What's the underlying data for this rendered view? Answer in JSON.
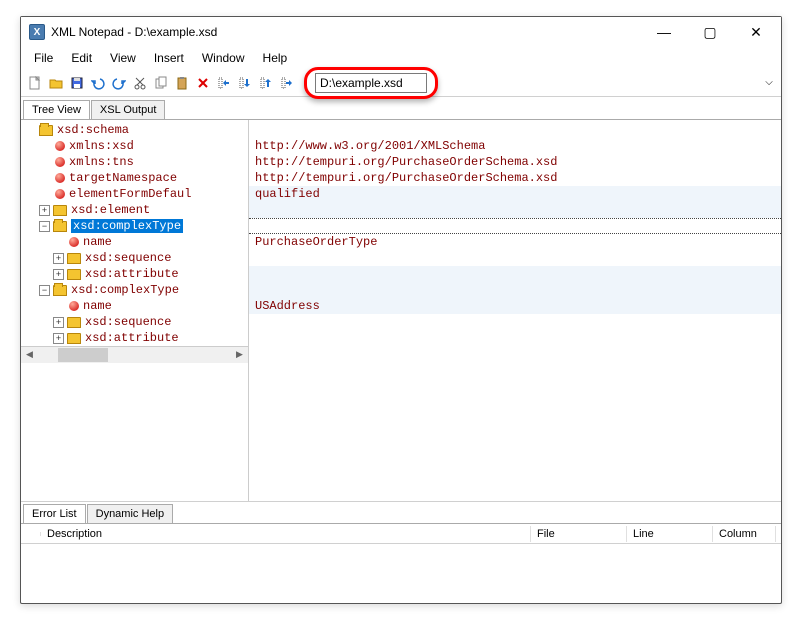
{
  "window": {
    "title": "XML Notepad - D:\\example.xsd"
  },
  "menubar": {
    "items": [
      "File",
      "Edit",
      "View",
      "Insert",
      "Window",
      "Help"
    ]
  },
  "address": {
    "value": "D:\\example.xsd"
  },
  "top_tabs": {
    "tree": "Tree View",
    "xsl": "XSL Output"
  },
  "tree": {
    "rows": [
      {
        "indent": 0,
        "exp": "open",
        "icon": "folder-open",
        "label": "xsd:schema"
      },
      {
        "indent": 1,
        "exp": "",
        "icon": "ball",
        "label": "xmlns:xsd"
      },
      {
        "indent": 1,
        "exp": "",
        "icon": "ball",
        "label": "xmlns:tns"
      },
      {
        "indent": 1,
        "exp": "",
        "icon": "ball",
        "label": "targetNamespace"
      },
      {
        "indent": 1,
        "exp": "",
        "icon": "ball",
        "label": "elementFormDefaul"
      },
      {
        "indent": 1,
        "exp": "plus",
        "icon": "folder",
        "label": "xsd:element"
      },
      {
        "indent": 1,
        "exp": "minus",
        "icon": "folder-open",
        "label": "xsd:complexType",
        "selected": true
      },
      {
        "indent": 2,
        "exp": "",
        "icon": "ball",
        "label": "name"
      },
      {
        "indent": 2,
        "exp": "plus",
        "icon": "folder",
        "label": "xsd:sequence"
      },
      {
        "indent": 2,
        "exp": "plus",
        "icon": "folder",
        "label": "xsd:attribute"
      },
      {
        "indent": 1,
        "exp": "minus",
        "icon": "folder-open",
        "label": "xsd:complexType"
      },
      {
        "indent": 2,
        "exp": "",
        "icon": "ball",
        "label": "name"
      },
      {
        "indent": 2,
        "exp": "plus",
        "icon": "folder",
        "label": "xsd:sequence"
      },
      {
        "indent": 2,
        "exp": "plus",
        "icon": "folder",
        "label": "xsd:attribute"
      }
    ]
  },
  "values": [
    "",
    "http://www.w3.org/2001/XMLSchema",
    "http://tempuri.org/PurchaseOrderSchema.xsd",
    "http://tempuri.org/PurchaseOrderSchema.xsd",
    "qualified",
    "",
    "",
    "PurchaseOrderType",
    "",
    "",
    "",
    "USAddress",
    "",
    ""
  ],
  "value_alt_rows": [
    4,
    5,
    6,
    9,
    10,
    11
  ],
  "value_selected_row": 6,
  "bottom_tabs": {
    "errors": "Error List",
    "help": "Dynamic Help"
  },
  "columns": {
    "desc": "Description",
    "file": "File",
    "line": "Line",
    "col": "Column"
  }
}
